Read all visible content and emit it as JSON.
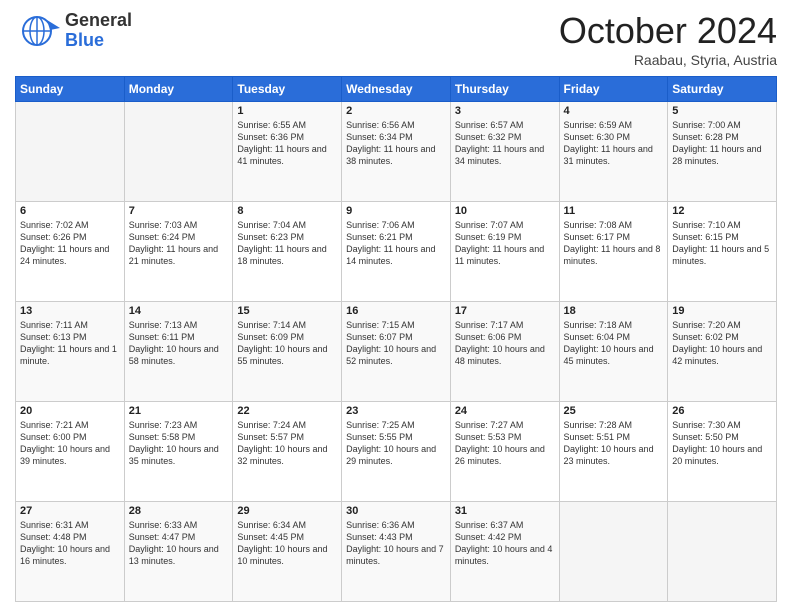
{
  "logo": {
    "general": "General",
    "blue": "Blue"
  },
  "header": {
    "month": "October 2024",
    "location": "Raabau, Styria, Austria"
  },
  "weekdays": [
    "Sunday",
    "Monday",
    "Tuesday",
    "Wednesday",
    "Thursday",
    "Friday",
    "Saturday"
  ],
  "weeks": [
    [
      {
        "day": "",
        "sunrise": "",
        "sunset": "",
        "daylight": ""
      },
      {
        "day": "",
        "sunrise": "",
        "sunset": "",
        "daylight": ""
      },
      {
        "day": "1",
        "sunrise": "Sunrise: 6:55 AM",
        "sunset": "Sunset: 6:36 PM",
        "daylight": "Daylight: 11 hours and 41 minutes."
      },
      {
        "day": "2",
        "sunrise": "Sunrise: 6:56 AM",
        "sunset": "Sunset: 6:34 PM",
        "daylight": "Daylight: 11 hours and 38 minutes."
      },
      {
        "day": "3",
        "sunrise": "Sunrise: 6:57 AM",
        "sunset": "Sunset: 6:32 PM",
        "daylight": "Daylight: 11 hours and 34 minutes."
      },
      {
        "day": "4",
        "sunrise": "Sunrise: 6:59 AM",
        "sunset": "Sunset: 6:30 PM",
        "daylight": "Daylight: 11 hours and 31 minutes."
      },
      {
        "day": "5",
        "sunrise": "Sunrise: 7:00 AM",
        "sunset": "Sunset: 6:28 PM",
        "daylight": "Daylight: 11 hours and 28 minutes."
      }
    ],
    [
      {
        "day": "6",
        "sunrise": "Sunrise: 7:02 AM",
        "sunset": "Sunset: 6:26 PM",
        "daylight": "Daylight: 11 hours and 24 minutes."
      },
      {
        "day": "7",
        "sunrise": "Sunrise: 7:03 AM",
        "sunset": "Sunset: 6:24 PM",
        "daylight": "Daylight: 11 hours and 21 minutes."
      },
      {
        "day": "8",
        "sunrise": "Sunrise: 7:04 AM",
        "sunset": "Sunset: 6:23 PM",
        "daylight": "Daylight: 11 hours and 18 minutes."
      },
      {
        "day": "9",
        "sunrise": "Sunrise: 7:06 AM",
        "sunset": "Sunset: 6:21 PM",
        "daylight": "Daylight: 11 hours and 14 minutes."
      },
      {
        "day": "10",
        "sunrise": "Sunrise: 7:07 AM",
        "sunset": "Sunset: 6:19 PM",
        "daylight": "Daylight: 11 hours and 11 minutes."
      },
      {
        "day": "11",
        "sunrise": "Sunrise: 7:08 AM",
        "sunset": "Sunset: 6:17 PM",
        "daylight": "Daylight: 11 hours and 8 minutes."
      },
      {
        "day": "12",
        "sunrise": "Sunrise: 7:10 AM",
        "sunset": "Sunset: 6:15 PM",
        "daylight": "Daylight: 11 hours and 5 minutes."
      }
    ],
    [
      {
        "day": "13",
        "sunrise": "Sunrise: 7:11 AM",
        "sunset": "Sunset: 6:13 PM",
        "daylight": "Daylight: 11 hours and 1 minute."
      },
      {
        "day": "14",
        "sunrise": "Sunrise: 7:13 AM",
        "sunset": "Sunset: 6:11 PM",
        "daylight": "Daylight: 10 hours and 58 minutes."
      },
      {
        "day": "15",
        "sunrise": "Sunrise: 7:14 AM",
        "sunset": "Sunset: 6:09 PM",
        "daylight": "Daylight: 10 hours and 55 minutes."
      },
      {
        "day": "16",
        "sunrise": "Sunrise: 7:15 AM",
        "sunset": "Sunset: 6:07 PM",
        "daylight": "Daylight: 10 hours and 52 minutes."
      },
      {
        "day": "17",
        "sunrise": "Sunrise: 7:17 AM",
        "sunset": "Sunset: 6:06 PM",
        "daylight": "Daylight: 10 hours and 48 minutes."
      },
      {
        "day": "18",
        "sunrise": "Sunrise: 7:18 AM",
        "sunset": "Sunset: 6:04 PM",
        "daylight": "Daylight: 10 hours and 45 minutes."
      },
      {
        "day": "19",
        "sunrise": "Sunrise: 7:20 AM",
        "sunset": "Sunset: 6:02 PM",
        "daylight": "Daylight: 10 hours and 42 minutes."
      }
    ],
    [
      {
        "day": "20",
        "sunrise": "Sunrise: 7:21 AM",
        "sunset": "Sunset: 6:00 PM",
        "daylight": "Daylight: 10 hours and 39 minutes."
      },
      {
        "day": "21",
        "sunrise": "Sunrise: 7:23 AM",
        "sunset": "Sunset: 5:58 PM",
        "daylight": "Daylight: 10 hours and 35 minutes."
      },
      {
        "day": "22",
        "sunrise": "Sunrise: 7:24 AM",
        "sunset": "Sunset: 5:57 PM",
        "daylight": "Daylight: 10 hours and 32 minutes."
      },
      {
        "day": "23",
        "sunrise": "Sunrise: 7:25 AM",
        "sunset": "Sunset: 5:55 PM",
        "daylight": "Daylight: 10 hours and 29 minutes."
      },
      {
        "day": "24",
        "sunrise": "Sunrise: 7:27 AM",
        "sunset": "Sunset: 5:53 PM",
        "daylight": "Daylight: 10 hours and 26 minutes."
      },
      {
        "day": "25",
        "sunrise": "Sunrise: 7:28 AM",
        "sunset": "Sunset: 5:51 PM",
        "daylight": "Daylight: 10 hours and 23 minutes."
      },
      {
        "day": "26",
        "sunrise": "Sunrise: 7:30 AM",
        "sunset": "Sunset: 5:50 PM",
        "daylight": "Daylight: 10 hours and 20 minutes."
      }
    ],
    [
      {
        "day": "27",
        "sunrise": "Sunrise: 6:31 AM",
        "sunset": "Sunset: 4:48 PM",
        "daylight": "Daylight: 10 hours and 16 minutes."
      },
      {
        "day": "28",
        "sunrise": "Sunrise: 6:33 AM",
        "sunset": "Sunset: 4:47 PM",
        "daylight": "Daylight: 10 hours and 13 minutes."
      },
      {
        "day": "29",
        "sunrise": "Sunrise: 6:34 AM",
        "sunset": "Sunset: 4:45 PM",
        "daylight": "Daylight: 10 hours and 10 minutes."
      },
      {
        "day": "30",
        "sunrise": "Sunrise: 6:36 AM",
        "sunset": "Sunset: 4:43 PM",
        "daylight": "Daylight: 10 hours and 7 minutes."
      },
      {
        "day": "31",
        "sunrise": "Sunrise: 6:37 AM",
        "sunset": "Sunset: 4:42 PM",
        "daylight": "Daylight: 10 hours and 4 minutes."
      },
      {
        "day": "",
        "sunrise": "",
        "sunset": "",
        "daylight": ""
      },
      {
        "day": "",
        "sunrise": "",
        "sunset": "",
        "daylight": ""
      }
    ]
  ]
}
